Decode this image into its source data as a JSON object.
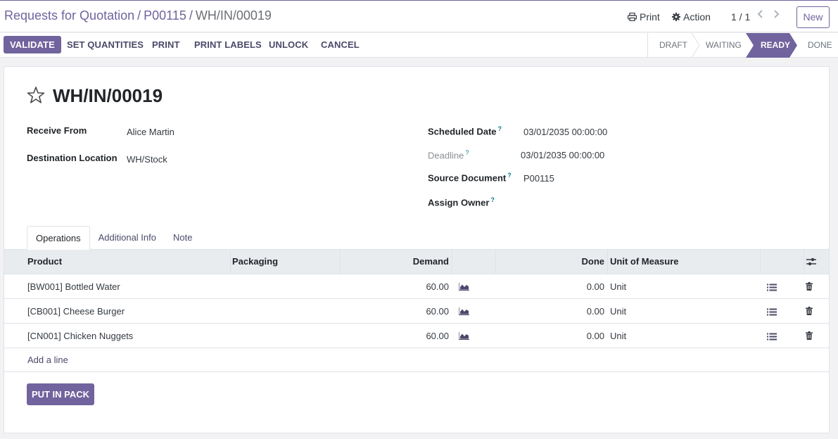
{
  "breadcrumb": {
    "root": "Requests for Quotation",
    "parent": "P00115",
    "current": "WH/IN/00019",
    "separator": "/"
  },
  "control_panel": {
    "print_label": "Print",
    "action_label": "Action",
    "pager": "1 / 1",
    "new_label": "New"
  },
  "statusbar": {
    "buttons": [
      "VALIDATE",
      "SET QUANTITIES",
      "PRINT",
      "PRINT LABELS",
      "UNLOCK",
      "CANCEL"
    ],
    "stages": [
      "DRAFT",
      "WAITING",
      "READY",
      "DONE"
    ],
    "active_stage": "READY"
  },
  "record": {
    "title": "WH/IN/00019",
    "receive_from_label": "Receive From",
    "receive_from": "Alice Martin",
    "destination_label": "Destination Location",
    "destination": "WH/Stock",
    "scheduled_date_label": "Scheduled Date",
    "scheduled_date": "03/01/2035 00:00:00",
    "deadline_label": "Deadline",
    "deadline": "03/01/2035 00:00:00",
    "source_document_label": "Source Document",
    "source_document": "P00115",
    "assign_owner_label": "Assign Owner",
    "help_mark": "?"
  },
  "tabs": [
    "Operations",
    "Additional Info",
    "Note"
  ],
  "table": {
    "columns": [
      "Product",
      "Packaging",
      "Demand",
      "Done",
      "Unit of Measure"
    ],
    "rows": [
      {
        "product": "[BW001] Bottled Water",
        "packaging": "",
        "demand": "60.00",
        "done": "0.00",
        "uom": "Unit"
      },
      {
        "product": "[CB001] Cheese Burger",
        "packaging": "",
        "demand": "60.00",
        "done": "0.00",
        "uom": "Unit"
      },
      {
        "product": "[CN001] Chicken Nuggets",
        "packaging": "",
        "demand": "60.00",
        "done": "0.00",
        "uom": "Unit"
      }
    ],
    "add_line": "Add a line"
  },
  "put_in_pack": "PUT IN PACK",
  "colors": {
    "brand": "#71639e",
    "teal": "#017e84"
  }
}
